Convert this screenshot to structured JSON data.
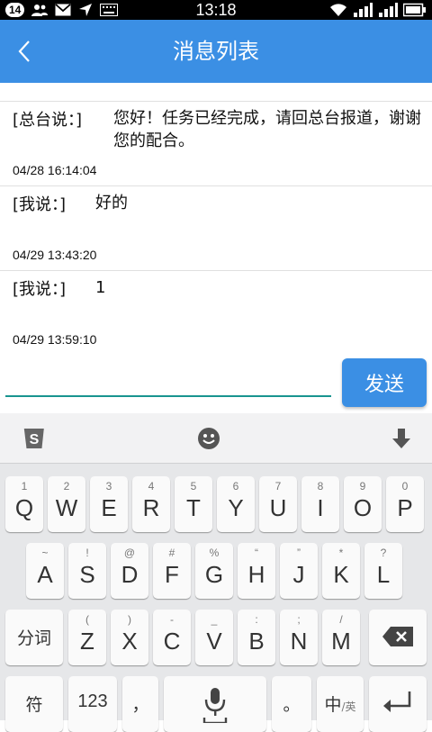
{
  "status_bar": {
    "notification_count": "14",
    "time": "13:18"
  },
  "app_bar": {
    "title": "消息列表"
  },
  "messages": [
    {
      "sender": "[总台说：]",
      "text": "您好！任务已经完成，请回总台报道，谢谢您的配合。",
      "time": "04/28 16:14:04"
    },
    {
      "sender": "[我说：]",
      "text": "好的",
      "time": "04/29 13:43:20"
    },
    {
      "sender": "[我说：]",
      "text": "1",
      "time": "04/29 13:59:10"
    }
  ],
  "composer": {
    "value": "",
    "send_label": "发送"
  },
  "keyboard": {
    "row1": [
      {
        "key": "Q",
        "hint": "1"
      },
      {
        "key": "W",
        "hint": "2"
      },
      {
        "key": "E",
        "hint": "3"
      },
      {
        "key": "R",
        "hint": "4"
      },
      {
        "key": "T",
        "hint": "5"
      },
      {
        "key": "Y",
        "hint": "6"
      },
      {
        "key": "U",
        "hint": "7"
      },
      {
        "key": "I",
        "hint": "8"
      },
      {
        "key": "O",
        "hint": "9"
      },
      {
        "key": "P",
        "hint": "0"
      }
    ],
    "row2": [
      {
        "key": "A",
        "hint": "~"
      },
      {
        "key": "S",
        "hint": "!"
      },
      {
        "key": "D",
        "hint": "@"
      },
      {
        "key": "F",
        "hint": "#"
      },
      {
        "key": "G",
        "hint": "%"
      },
      {
        "key": "H",
        "hint": "“"
      },
      {
        "key": "J",
        "hint": "”"
      },
      {
        "key": "K",
        "hint": "*"
      },
      {
        "key": "L",
        "hint": "?"
      }
    ],
    "row3": [
      {
        "key": "Z",
        "hint": "("
      },
      {
        "key": "X",
        "hint": ")"
      },
      {
        "key": "C",
        "hint": "-"
      },
      {
        "key": "V",
        "hint": "_"
      },
      {
        "key": "B",
        "hint": ":"
      },
      {
        "key": "N",
        "hint": ";"
      },
      {
        "key": "M",
        "hint": "/"
      }
    ],
    "segment_label": "分词",
    "symbol_label": "符",
    "number_label": "123",
    "comma_label": "，",
    "period_label": "。",
    "lang_label": "中",
    "lang_alt_label": "/英"
  }
}
